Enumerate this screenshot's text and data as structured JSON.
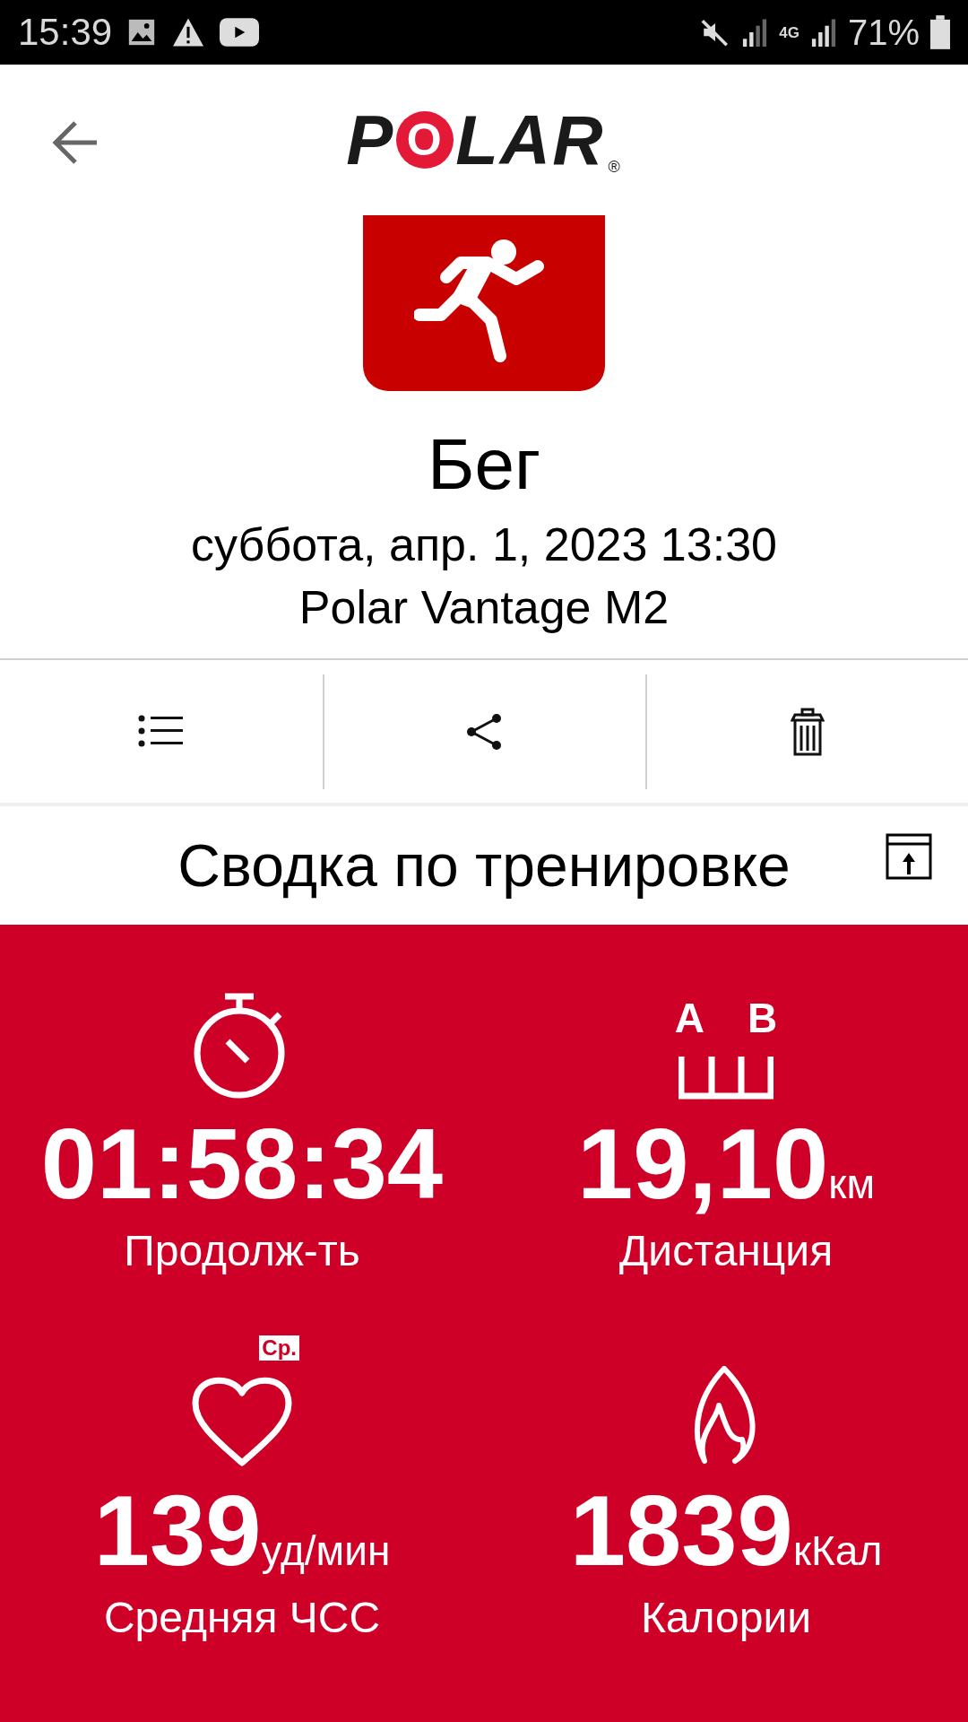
{
  "status_bar": {
    "time": "15:39",
    "network": "4G",
    "battery": "71%"
  },
  "header": {
    "logo": "POLAR",
    "registered": "®"
  },
  "activity": {
    "title": "Бег",
    "date": "суббота, апр. 1, 2023 13:30",
    "device": "Polar Vantage M2"
  },
  "actions": [
    {
      "kind": "list"
    },
    {
      "kind": "share"
    },
    {
      "kind": "delete"
    }
  ],
  "summary": {
    "title": "Сводка по тренировке"
  },
  "stats": [
    {
      "kind": "duration",
      "value": "01:58:34",
      "label": "Продолж-ть"
    },
    {
      "kind": "distance",
      "value": "19,10",
      "unit": "км",
      "label": "Дистанция",
      "icon_labels": [
        "A",
        "B"
      ]
    },
    {
      "kind": "heart_rate",
      "value": "139",
      "unit": "уд/мин",
      "label": "Средняя ЧСС",
      "badge": "Ср."
    },
    {
      "kind": "calories",
      "value": "1839",
      "unit": "кКал",
      "label": "Калории"
    }
  ]
}
